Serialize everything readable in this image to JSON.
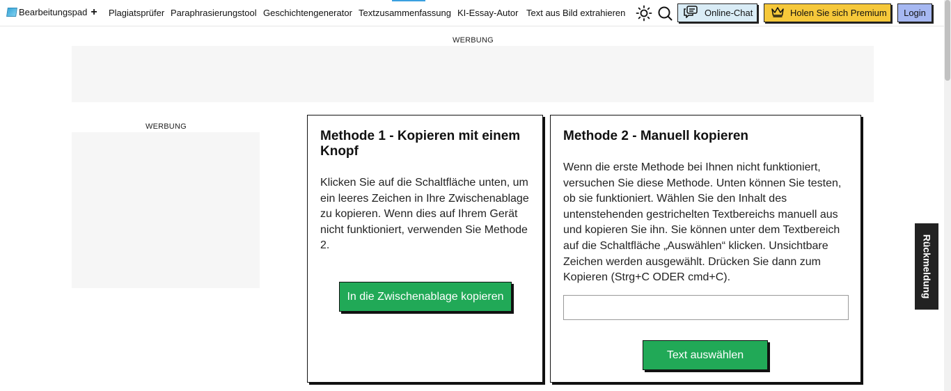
{
  "nav": {
    "brand": "Bearbeitungspad",
    "brand_plus": "+",
    "links": [
      "Plagiatsprüfer",
      "Paraphrasierungstool",
      "Geschichtengenerator",
      "Textzusammenfassung",
      "KI-Essay-Autor",
      "Text aus Bild extrahieren"
    ],
    "chat_label": "Online-Chat",
    "premium_label": "Holen Sie sich Premium",
    "login_label": "Login",
    "icons": {
      "theme": "sun-icon",
      "search": "search-icon",
      "chat": "chat-bubble-icon",
      "premium": "crown-icon"
    }
  },
  "ads": {
    "top_label": "WERBUNG",
    "side_label": "WERBUNG"
  },
  "method1": {
    "title": "Methode 1 - Kopieren mit einem Knopf",
    "body": "Klicken Sie auf die Schaltfläche unten, um ein leeres Zeichen in Ihre Zwischenablage zu kopieren. Wenn dies auf Ihrem Gerät nicht funktioniert, verwenden Sie Methode 2.",
    "button": "In die Zwischenablage kopieren"
  },
  "method2": {
    "title": "Methode 2 - Manuell kopieren",
    "body": "Wenn die erste Methode bei Ihnen nicht funktioniert, versuchen Sie diese Methode. Unten können Sie testen, ob sie funktioniert. Wählen Sie den Inhalt des untenstehenden gestrichelten Textbereichs manuell aus und kopieren Sie ihn. Sie können unter dem Textbereich auf die Schaltfläche „Auswählen“ klicken. Unsichtbare Zeichen werden ausgewählt. Drücken Sie dann zum Kopieren (Strg+C ODER cmd+C).",
    "textarea_value": "",
    "button": "Text auswählen"
  },
  "feedback": {
    "label": "Rückmeldung"
  },
  "colors": {
    "green": "#21a957",
    "chat": "#d9ecf6",
    "premium": "#f6c83a",
    "login": "#a6b8f2"
  }
}
